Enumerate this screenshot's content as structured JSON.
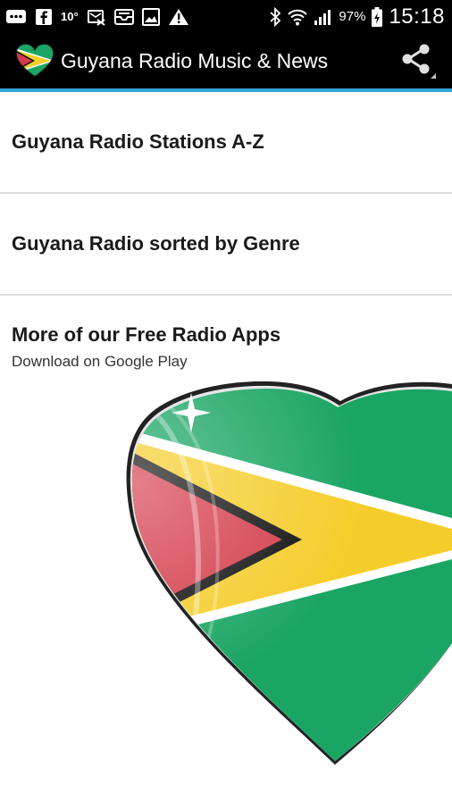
{
  "status_bar": {
    "temperature": "10°",
    "battery_percent": "97%",
    "clock": "15:18",
    "icons_left": [
      "message-icon",
      "facebook-icon",
      "temperature-text",
      "missed-call-icon",
      "mail-icon",
      "gallery-icon",
      "warning-icon"
    ],
    "icons_right": [
      "bluetooth-icon",
      "wifi-icon",
      "signal-icon",
      "battery-icon"
    ]
  },
  "action_bar": {
    "title": "Guyana Radio Music & News",
    "icon": "guyana-heart-flag-icon",
    "share_icon": "share-icon",
    "accent_color": "#35a4d6"
  },
  "menu": {
    "items": [
      {
        "label": "Guyana Radio Stations A-Z"
      },
      {
        "label": "Guyana Radio sorted by Genre"
      }
    ]
  },
  "promo": {
    "title": "More of our Free Radio Apps",
    "subtitle": "Download on Google Play",
    "image": "guyana-heart-flag-image"
  },
  "colors": {
    "flag_green": "#1aa564",
    "flag_yellow": "#f5cd2b",
    "flag_red": "#d43a4a",
    "flag_white": "#ffffff",
    "flag_black": "#111111"
  }
}
